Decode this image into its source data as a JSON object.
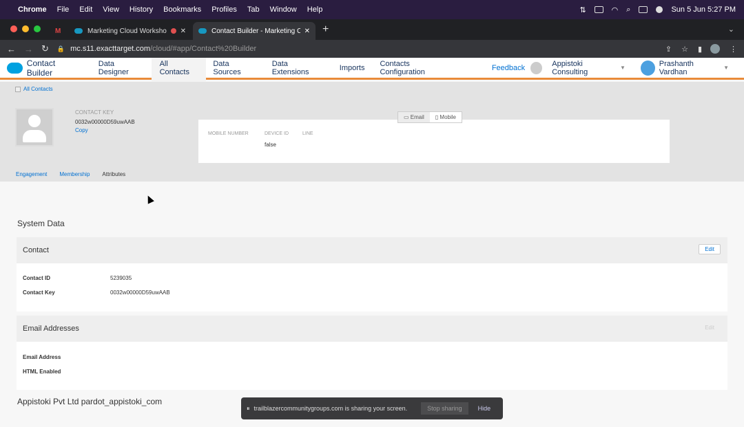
{
  "menubar": {
    "app": "Chrome",
    "items": [
      "File",
      "Edit",
      "View",
      "History",
      "Bookmarks",
      "Profiles",
      "Tab",
      "Window",
      "Help"
    ],
    "datetime": "Sun 5 Jun  5:27 PM"
  },
  "tabs": [
    {
      "title": "Marketing Cloud Worksho"
    },
    {
      "title": "Contact Builder - Marketing Cl"
    }
  ],
  "address": {
    "host": "mc.s11.exacttarget.com",
    "path": "/cloud/#app/Contact%20Builder"
  },
  "sfnav": {
    "brand": "Contact Builder",
    "links": [
      "Data Designer",
      "All Contacts",
      "Data Sources",
      "Data Extensions",
      "Imports",
      "Contacts Configuration"
    ],
    "feedback": "Feedback",
    "org": "Appistoki Consulting",
    "user": "Prashanth Vardhan"
  },
  "header": {
    "crumb": "All Contacts",
    "contact_label": "CONTACT KEY",
    "contact_key": "0032w00000D59uwAAB",
    "copy": "Copy",
    "toggle": [
      "Email",
      "Mobile"
    ],
    "fields": [
      "MOBILE NUMBER",
      "DEVICE ID",
      "LINE"
    ],
    "device_val": "false",
    "subtabs": [
      "Engagement",
      "Membership",
      "Attributes"
    ]
  },
  "system": {
    "title": "System Data",
    "contact": {
      "head": "Contact",
      "edit": "Edit",
      "rows": [
        {
          "k": "Contact ID",
          "v": "5239035"
        },
        {
          "k": "Contact Key",
          "v": "0032w00000D59uwAAB"
        }
      ]
    },
    "email": {
      "head": "Email Addresses",
      "edit": "Edit",
      "rows": [
        {
          "k": "Email Address"
        },
        {
          "k": "HTML Enabled"
        }
      ]
    },
    "org_title": "Appistoki Pvt Ltd pardot_appistoki_com"
  },
  "share": {
    "text": "trailblazercommunitygroups.com is sharing your screen.",
    "stop": "Stop sharing",
    "hide": "Hide"
  }
}
